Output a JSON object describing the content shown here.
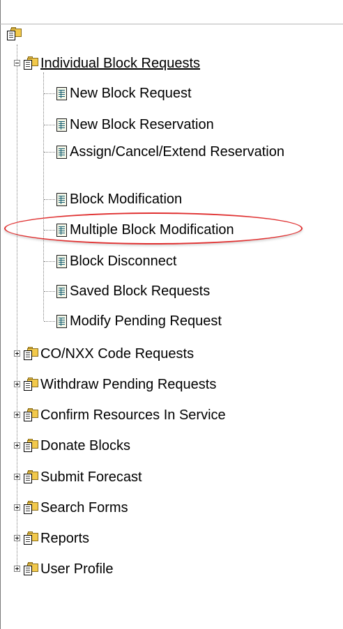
{
  "tree": {
    "root_icon": "folder-doc-icon",
    "expanded_group": {
      "label": "Individual Block Requests",
      "icon": "folder-doc-icon",
      "expander": "minus",
      "children": [
        {
          "label": "New Block Request",
          "icon": "document-icon"
        },
        {
          "label": "New Block Reservation",
          "icon": "document-icon"
        },
        {
          "label": "Assign/Cancel/Extend Reservation",
          "icon": "document-icon"
        },
        {
          "label": "Block Modification",
          "icon": "document-icon"
        },
        {
          "label": "Multiple Block Modification",
          "icon": "document-icon",
          "highlighted": true
        },
        {
          "label": "Block Disconnect",
          "icon": "document-icon"
        },
        {
          "label": "Saved Block Requests",
          "icon": "document-icon"
        },
        {
          "label": "Modify Pending Request",
          "icon": "document-icon"
        }
      ]
    },
    "collapsed_groups": [
      {
        "label": "CO/NXX Code Requests",
        "expander": "plus"
      },
      {
        "label": "Withdraw Pending Requests",
        "expander": "plus"
      },
      {
        "label": "Confirm Resources In Service",
        "expander": "plus"
      },
      {
        "label": "Donate Blocks",
        "expander": "plus"
      },
      {
        "label": "Submit Forecast",
        "expander": "plus"
      },
      {
        "label": "Search Forms",
        "expander": "plus"
      },
      {
        "label": "Reports",
        "expander": "plus"
      },
      {
        "label": "User Profile",
        "expander": "plus"
      }
    ]
  },
  "colors": {
    "highlight_ellipse": "#e03030",
    "folder": "#f2c94c",
    "tree_line": "#808080"
  }
}
